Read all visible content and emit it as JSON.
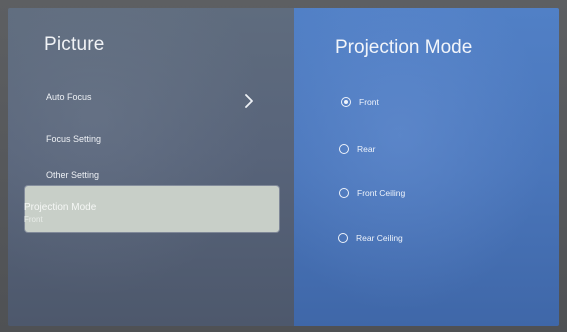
{
  "left": {
    "title": "Picture",
    "items": [
      {
        "label": "Auto Focus",
        "has_arrow": true
      },
      {
        "label": "Focus Setting",
        "has_arrow": false
      },
      {
        "label": "Other Setting",
        "has_arrow": false
      }
    ],
    "selected": {
      "label": "Projection Mode",
      "value": "Front"
    }
  },
  "right": {
    "title": "Projection Mode",
    "options": [
      {
        "label": "Front",
        "checked": true
      },
      {
        "label": "Rear",
        "checked": false
      },
      {
        "label": "Front Ceiling",
        "checked": false
      },
      {
        "label": "Rear Ceiling",
        "checked": false
      }
    ]
  },
  "icons": {
    "chevron": "chevron-right-icon",
    "radio": "radio-icon"
  }
}
